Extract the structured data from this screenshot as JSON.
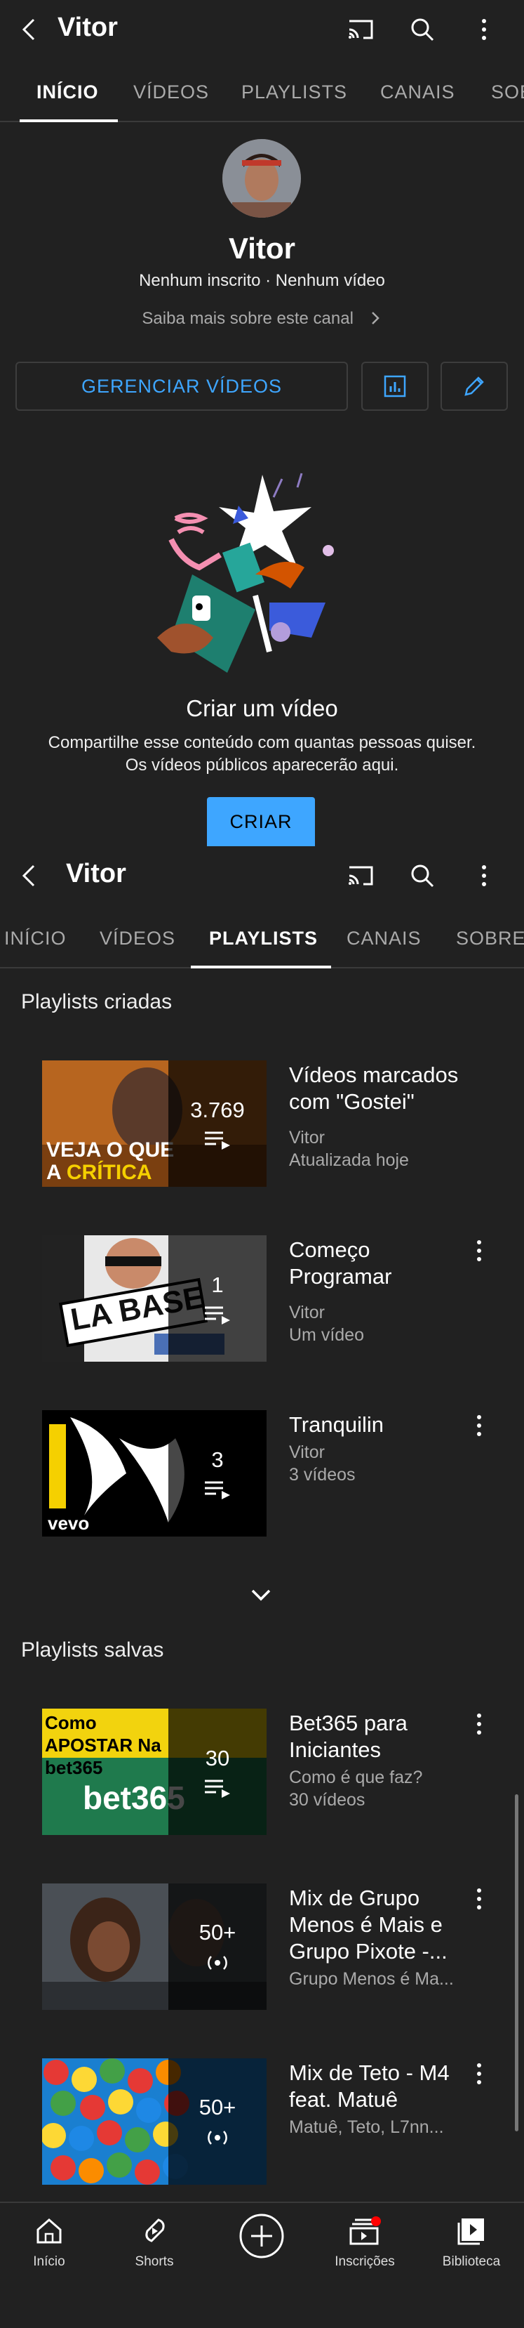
{
  "screen1": {
    "header": {
      "title": "Vitor"
    },
    "tabs": [
      {
        "label": "INÍCIO"
      },
      {
        "label": "VÍDEOS"
      },
      {
        "label": "PLAYLISTS"
      },
      {
        "label": "CANAIS"
      },
      {
        "label": "SOBRE"
      }
    ],
    "channel": {
      "name": "Vitor",
      "stats": "Nenhum inscrito · Nenhum vídeo",
      "about_link": "Saiba mais sobre este canal"
    },
    "buttons": {
      "manage": "GERENCIAR VÍDEOS",
      "create": "CRIAR"
    },
    "empty_state": {
      "title": "Criar um vídeo",
      "line1": "Compartilhe esse conteúdo com quantas pessoas quiser.",
      "line2": "Os vídeos públicos aparecerão aqui."
    }
  },
  "screen2": {
    "header": {
      "title": "Vitor"
    },
    "tabs": [
      {
        "label": "INÍCIO"
      },
      {
        "label": "VÍDEOS"
      },
      {
        "label": "PLAYLISTS"
      },
      {
        "label": "CANAIS"
      },
      {
        "label": "SOBRE"
      }
    ],
    "created_title": "Playlists criadas",
    "created": [
      {
        "title": "Vídeos marcados com \"Gostei\"",
        "channel": "Vitor",
        "meta": "Atualizada hoje",
        "count": "3.769",
        "thumb_text": "VEJA O QUE A CRÍTICA ACHOU"
      },
      {
        "title": "Começo Programar",
        "channel": "Vitor",
        "meta": "Um vídeo",
        "count": "1",
        "thumb_text": "LA BASE"
      },
      {
        "title": "Tranquilin",
        "channel": "Vitor",
        "meta": "3 vídeos",
        "count": "3",
        "thumb_text": "vevo"
      }
    ],
    "saved_title": "Playlists salvas",
    "saved": [
      {
        "title": "Bet365 para Iniciantes",
        "channel": "Como é que faz?",
        "meta": "30 vídeos",
        "count": "30",
        "thumb_text": "Como APOSTAR Na bet365"
      },
      {
        "title": "Mix de Grupo Menos é Mais e Grupo Pixote -...",
        "channel": "Grupo Menos é Ma...",
        "meta": "",
        "count": "50+"
      },
      {
        "title": "Mix de Teto - M4 feat. Matuê",
        "channel": "Matuê, Teto, L7nn...",
        "meta": "",
        "count": "50+"
      }
    ],
    "bottom_nav": [
      {
        "label": "Início",
        "icon": "home-icon"
      },
      {
        "label": "Shorts",
        "icon": "shorts-icon"
      },
      {
        "label": "",
        "icon": "create-icon"
      },
      {
        "label": "Inscrições",
        "icon": "subscriptions-icon"
      },
      {
        "label": "Biblioteca",
        "icon": "library-icon"
      }
    ],
    "colors": {
      "accent": "#3ea6ff",
      "background": "#212121",
      "notification": "#ff0000"
    }
  }
}
